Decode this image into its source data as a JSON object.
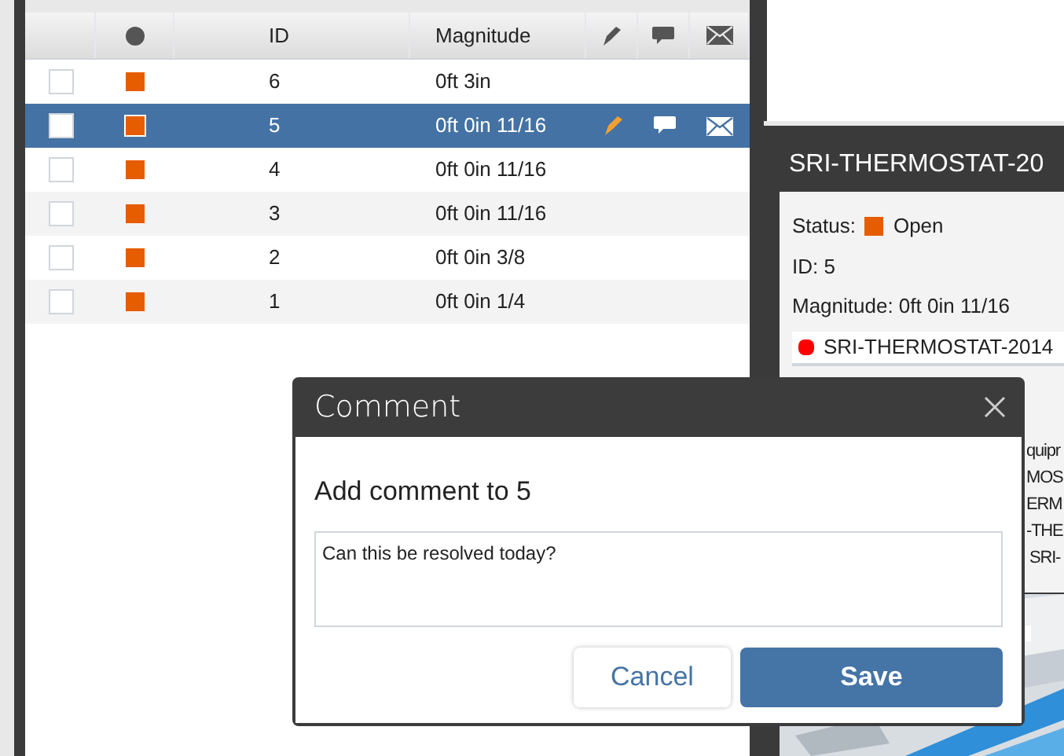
{
  "table": {
    "columns": [
      {
        "kind": "check"
      },
      {
        "kind": "status"
      },
      {
        "kind": "text",
        "label": "ID"
      },
      {
        "kind": "text",
        "label": "Magnitude"
      },
      {
        "kind": "markup"
      },
      {
        "kind": "comment"
      },
      {
        "kind": "email"
      }
    ],
    "rows": [
      {
        "checked": false,
        "selected": false,
        "color": "#e65c00",
        "id": "6",
        "magnitude": "0ft 3in",
        "markup": false,
        "comment": false,
        "email": false
      },
      {
        "checked": false,
        "selected": true,
        "color": "#e65c00",
        "id": "5",
        "magnitude": "0ft 0in 11/16",
        "markup": true,
        "comment": true,
        "email": true
      },
      {
        "checked": false,
        "selected": false,
        "color": "#e65c00",
        "id": "4",
        "magnitude": "0ft 0in 11/16",
        "markup": false,
        "comment": false,
        "email": false
      },
      {
        "checked": false,
        "selected": false,
        "color": "#e65c00",
        "id": "3",
        "magnitude": "0ft 0in 11/16",
        "markup": false,
        "comment": false,
        "email": false
      },
      {
        "checked": false,
        "selected": false,
        "color": "#e65c00",
        "id": "2",
        "magnitude": "0ft 0in 3/8",
        "markup": false,
        "comment": false,
        "email": false
      },
      {
        "checked": false,
        "selected": false,
        "color": "#e65c00",
        "id": "1",
        "magnitude": "0ft 0in 1/4",
        "markup": false,
        "comment": false,
        "email": false
      }
    ]
  },
  "detail": {
    "title": "SRI-THERMOSTAT-20",
    "status_label": "Status:",
    "status": "Open",
    "id": "ID: 5",
    "magnitude": "Magnitude: 0ft 0in 11/16",
    "item": {
      "label": "SRI-THERMOSTAT-2014",
      "color": "#ff0000"
    },
    "partial_lines": [
      "quipr",
      "MOS",
      "ERM",
      "-THE",
      "SRI-"
    ]
  },
  "dialog": {
    "title": "Comment",
    "heading": "Add comment to 5",
    "comment": "Can this be resolved today?",
    "buttons": [
      {
        "label": "Cancel",
        "kind": "secondary"
      },
      {
        "label": "Save",
        "kind": "primary"
      }
    ]
  }
}
